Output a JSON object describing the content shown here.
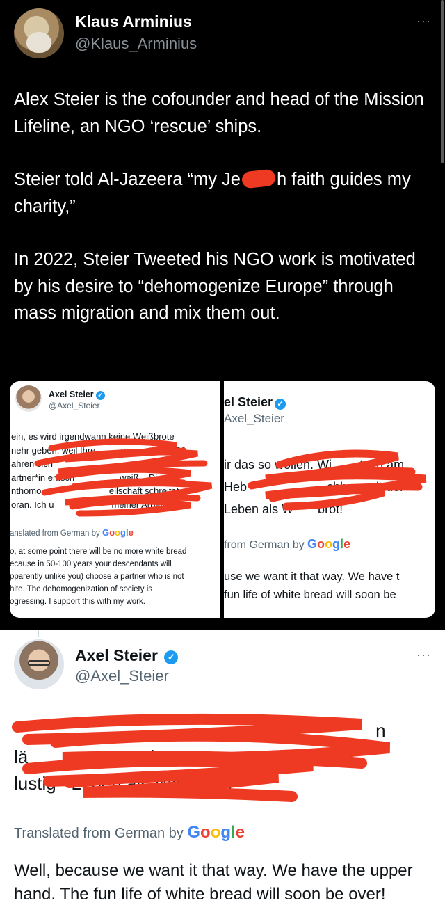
{
  "main_tweet": {
    "author_name": "Klaus Arminius",
    "author_handle": "@Klaus_Arminius",
    "more_label": "···",
    "para1": "Alex Steier is the cofounder and head of the Mission Lifeline, an NGO ‘rescue’ ships.",
    "para2_prefix": "Steier told Al-Jazeera “my Je",
    "para2_suffix": "h faith guides my charity,”",
    "para3": "In 2022, Steier Tweeted his NGO work is motivated by his desire to “dehomogenize Europe” through mass migration and mix them out."
  },
  "left_card": {
    "author_name": "Axel Steier",
    "author_handle": "@Axel_Steier",
    "german_text": "ein, es wird irgendwann keine Weißbrote\nnehr geben, weil Ihre          mmen in 50-100\nahren sich                                 ur ein*n\nartner*in entsch                  weiß    Die\nnthomo                           ellschaft schreitet\noran. Ich u                       meiner Arbeit.",
    "translated_label": "anslated from German by ",
    "google": "Google",
    "translation": "o, at some point there will be no more white bread\necause in 50-100 years your descendants will\npparently unlike you) choose a partner who is not\nhite. The dehomogenization of society is\nogressing. I support this with my work."
  },
  "right_card": {
    "author_name": "el Steier",
    "author_handle": "Axel_Steier",
    "german_text": "ir das so wollen. Wi        tzen am\nHeb                       chluss mit der\nLeben als W       brot!",
    "translated_label": "from German by ",
    "google": "Google",
    "translation": "use we want it that way. We have t\nfun life of white bread will soon be"
  },
  "reply_tweet": {
    "author_name": "Axel Steier",
    "author_handle": "@Axel_Steier",
    "more_label": "···",
    "german_text": "                                                                        n\nlä                 Das ist                               lam\nlustig   Leben als Weißbrot!",
    "translated_label": "Translated from German by ",
    "google": "Google",
    "translation": "Well, because we want it that way. We have the upper hand. The fun life of white bread will soon be over!"
  },
  "colors": {
    "background_dark": "#000000",
    "background_light": "#ffffff",
    "secondary_text": "#536471",
    "verified_blue": "#1d9bf0",
    "scribble_red": "#ee3a22"
  }
}
